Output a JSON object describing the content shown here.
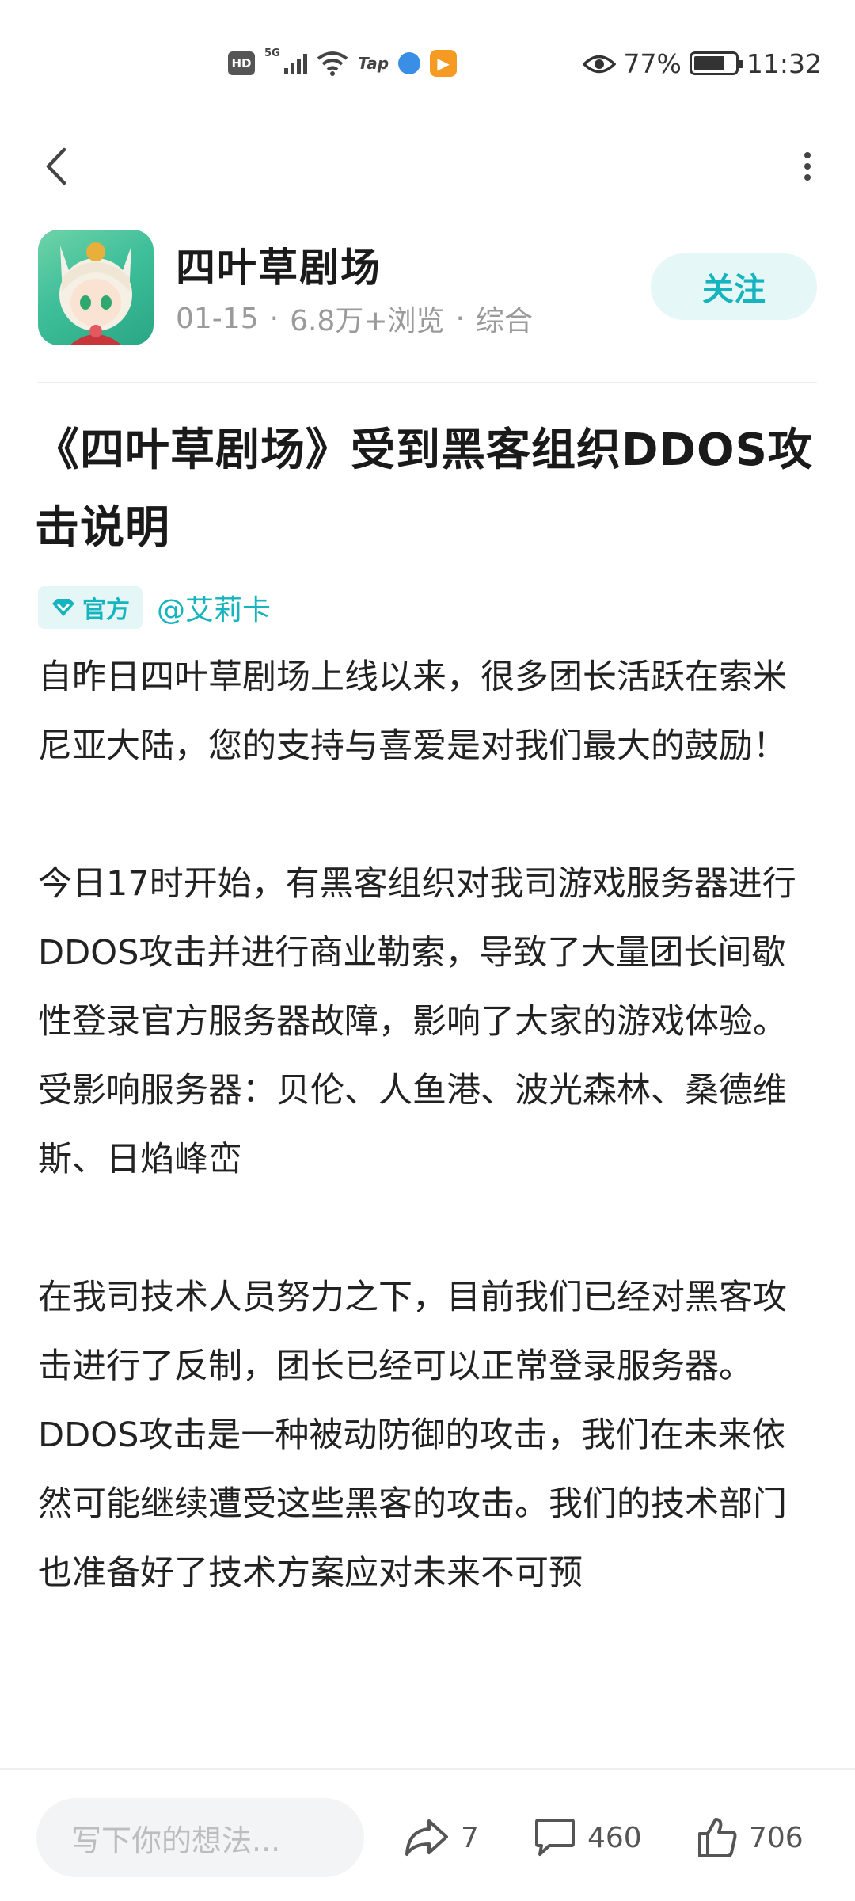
{
  "status_bar": {
    "badge": "HD",
    "network": "5G",
    "tap": "Tap",
    "battery": "77%",
    "time": "11:32"
  },
  "author": {
    "name": "四叶草剧场",
    "date": "01-15",
    "views": "6.8万+浏览",
    "category": "综合",
    "follow_label": "关注"
  },
  "article": {
    "title": "《四叶草剧场》受到黑客组织DDOS攻击说明",
    "official_tag": "官方",
    "mention": "@艾莉卡",
    "paragraphs": [
      "自昨日四叶草剧场上线以来，很多团长活跃在索米尼亚大陆，您的支持与喜爱是对我们最大的鼓励！",
      "",
      "今日17时开始，有黑客组织对我司游戏服务器进行DDOS攻击并进行商业勒索，导致了大量团长间歇性登录官方服务器故障，影响了大家的游戏体验。",
      "受影响服务器：贝伦、人鱼港、波光森林、桑德维斯、日焰峰峦",
      "",
      "在我司技术人员努力之下，目前我们已经对黑客攻击进行了反制，团长已经可以正常登录服务器。",
      "DDOS攻击是一种被动防御的攻击，我们在未来依然可能继续遭受这些黑客的攻击。我们的技术部门也准备好了技术方案应对未来不可预"
    ]
  },
  "bottom_bar": {
    "comment_placeholder": "写下你的想法...",
    "share_count": "7",
    "comment_count": "460",
    "like_count": "706"
  },
  "colors": {
    "accent": "#15b4bf",
    "accent_bg": "#e6f7f7"
  }
}
